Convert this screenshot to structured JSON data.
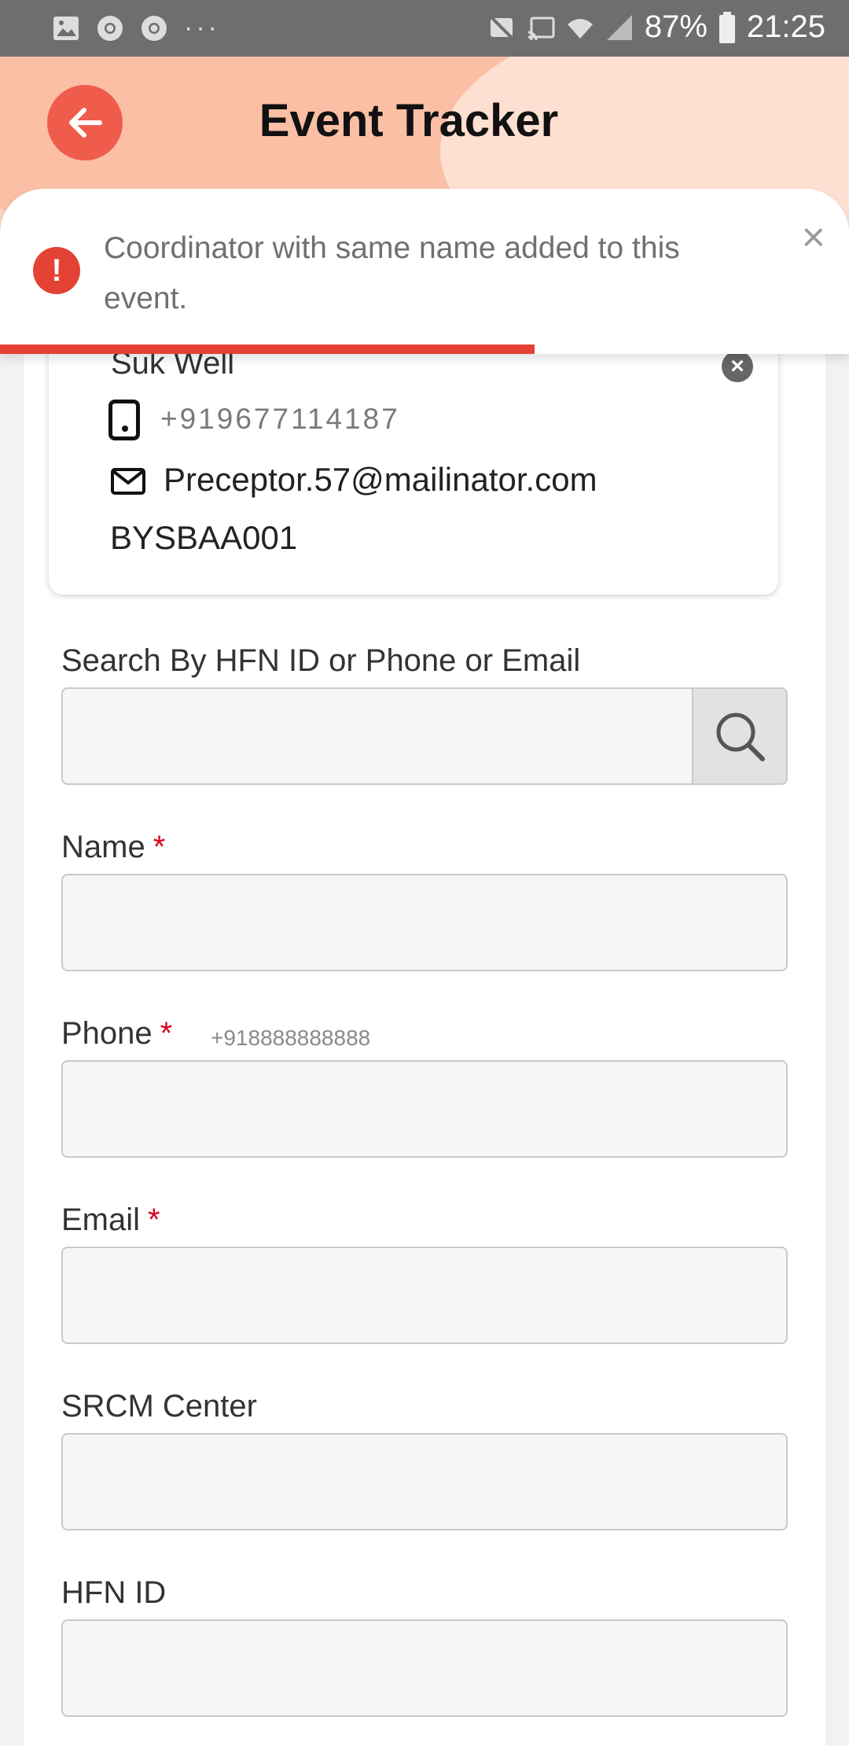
{
  "status_bar": {
    "battery": "87%",
    "time": "21:25",
    "left_icons": [
      "image-icon",
      "chrome-icon",
      "chrome-icon",
      "more-dots-icon"
    ],
    "right_icons": [
      "notifications-off-icon",
      "cast-icon",
      "wifi-icon",
      "signal-icon",
      "battery-icon"
    ]
  },
  "header": {
    "title": "Event Tracker",
    "back_icon": "arrow-left-icon"
  },
  "toast": {
    "message": "Coordinator with same name added to this event.",
    "close_label": "×",
    "icon": "error-icon",
    "progress": 0.63,
    "accent": "#e34234"
  },
  "coordinator": {
    "name": "Suk Well",
    "phone": "+919677114187",
    "email": "Preceptor.57@mailinator.com",
    "id": "BYSBAA001",
    "remove_icon": "close-circle-icon"
  },
  "form": {
    "search_label": "Search By HFN ID or Phone or Email",
    "search_value": "",
    "name_label": "Name",
    "name_value": "",
    "phone_label": "Phone",
    "phone_hint": "+918888888888",
    "phone_value": "",
    "email_label": "Email",
    "email_value": "",
    "center_label": "SRCM Center",
    "center_value": "",
    "hfn_label": "HFN ID",
    "hfn_value": "",
    "required_mark": "*"
  },
  "colors": {
    "primary": "#ef5c4b",
    "header_bg": "#fcd6c3",
    "required": "#d8001b"
  }
}
